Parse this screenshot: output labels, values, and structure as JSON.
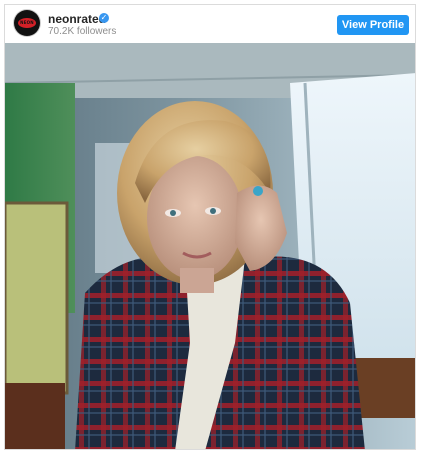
{
  "profile": {
    "username": "neonrated",
    "followers": "70.2K followers",
    "avatar_text": "NEON",
    "verified_icon": "verified-badge-icon"
  },
  "actions": {
    "view_profile_label": "View Profile"
  },
  "colors": {
    "button_bg": "#2196f3",
    "verified": "#3897f0",
    "logo_red": "#d32027"
  }
}
